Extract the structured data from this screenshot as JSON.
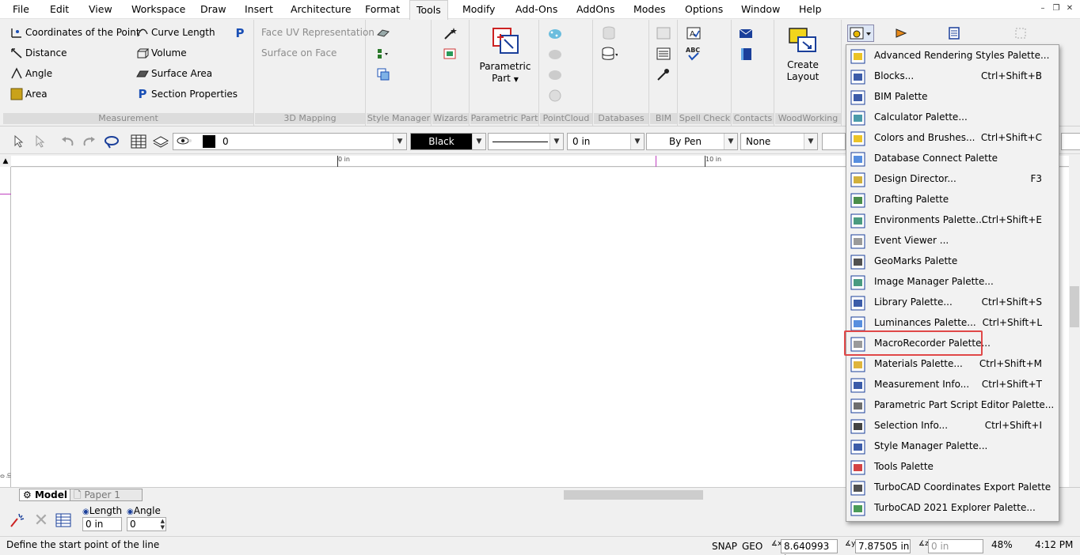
{
  "menu": {
    "items": [
      "File",
      "Edit",
      "View",
      "Workspace",
      "Draw",
      "Insert",
      "Architecture",
      "Format",
      "Tools",
      "Modify",
      "Add-Ons",
      "AddOns",
      "Modes",
      "Options",
      "Window",
      "Help"
    ],
    "active": "Tools"
  },
  "ribbon": {
    "measurement": {
      "label": "Measurement",
      "coords": "Coordinates of the Point",
      "curve_length": "Curve Length",
      "distance": "Distance",
      "volume": "Volume",
      "angle": "Angle",
      "surface_area": "Surface Area",
      "area": "Area",
      "section_props": "Section Properties"
    },
    "mapping": {
      "label": "3D Mapping",
      "face_uv": "Face UV Representation",
      "surface_on_face": "Surface on Face"
    },
    "style_manager": {
      "label": "Style Manager"
    },
    "wizards": {
      "label": "Wizards"
    },
    "parametric": {
      "label": "Parametric Part",
      "btn_line1": "Parametric",
      "btn_line2": "Part"
    },
    "pointcloud": {
      "label": "PointCloud"
    },
    "databases": {
      "label": "Databases"
    },
    "bim": {
      "label": "BIM"
    },
    "spellcheck": {
      "label": "Spell Check"
    },
    "contacts": {
      "label": "Contacts"
    },
    "woodworking": {
      "label": "WoodWorking",
      "btn_line1": "Create",
      "btn_line2": "Layout"
    }
  },
  "props": {
    "layer_value": "0",
    "color": "Black",
    "width": "0 in",
    "pen": "By Pen",
    "pattern": "None"
  },
  "ruler": {
    "zero": "0 in",
    "ten": "10 in",
    "side": "0 in"
  },
  "tabs": {
    "model": "Model",
    "paper": "Paper 1"
  },
  "inspector": {
    "length_label": "Length",
    "angle_label": "Angle",
    "length_value": "0 in",
    "angle_value": "0"
  },
  "status": {
    "message": "Define the start point of the line",
    "snap": "SNAP",
    "geo": "GEO",
    "x_value": "8.640993 in",
    "y_value": "7.87505 in",
    "z_value": "0 in",
    "zoom": "48%",
    "time": "4:12 PM"
  },
  "palettes": [
    {
      "label": "Advanced Rendering Styles Palette...",
      "shortcut": "",
      "icon": "rendering-icon"
    },
    {
      "label": "Blocks...",
      "shortcut": "Ctrl+Shift+B",
      "icon": "blocks-icon"
    },
    {
      "label": "BIM Palette",
      "shortcut": "",
      "icon": "bim-icon"
    },
    {
      "label": "Calculator Palette...",
      "shortcut": "",
      "icon": "calculator-icon"
    },
    {
      "label": "Colors and Brushes...",
      "shortcut": "Ctrl+Shift+C",
      "icon": "colors-icon"
    },
    {
      "label": "Database Connect Palette",
      "shortcut": "",
      "icon": "database-icon"
    },
    {
      "label": "Design Director...",
      "shortcut": "F3",
      "icon": "design-director-icon"
    },
    {
      "label": "Drafting Palette",
      "shortcut": "",
      "icon": "drafting-icon"
    },
    {
      "label": "Environments Palette...",
      "shortcut": "Ctrl+Shift+E",
      "icon": "environments-icon"
    },
    {
      "label": "Event Viewer ...",
      "shortcut": "",
      "icon": "event-viewer-icon"
    },
    {
      "label": "GeoMarks Palette",
      "shortcut": "",
      "icon": "geomarks-icon"
    },
    {
      "label": "Image Manager Palette...",
      "shortcut": "",
      "icon": "image-manager-icon"
    },
    {
      "label": "Library Palette...",
      "shortcut": "Ctrl+Shift+S",
      "icon": "library-icon"
    },
    {
      "label": "Luminances Palette...",
      "shortcut": "Ctrl+Shift+L",
      "icon": "luminances-icon"
    },
    {
      "label": "MacroRecorder Palette...",
      "shortcut": "",
      "icon": "macro-recorder-icon"
    },
    {
      "label": "Materials Palette...",
      "shortcut": "Ctrl+Shift+M",
      "icon": "materials-icon"
    },
    {
      "label": "Measurement Info...",
      "shortcut": "Ctrl+Shift+T",
      "icon": "measurement-info-icon"
    },
    {
      "label": "Parametric Part Script Editor Palette...",
      "shortcut": "",
      "icon": "script-editor-icon"
    },
    {
      "label": "Selection Info...",
      "shortcut": "Ctrl+Shift+I",
      "icon": "selection-info-icon"
    },
    {
      "label": "Style Manager Palette...",
      "shortcut": "",
      "icon": "style-manager-icon"
    },
    {
      "label": "Tools Palette",
      "shortcut": "",
      "icon": "tools-icon"
    },
    {
      "label": "TurboCAD Coordinates Export Palette",
      "shortcut": "",
      "icon": "coords-export-icon"
    },
    {
      "label": "TurboCAD 2021 Explorer Palette...",
      "shortcut": "",
      "icon": "explorer-icon"
    }
  ]
}
